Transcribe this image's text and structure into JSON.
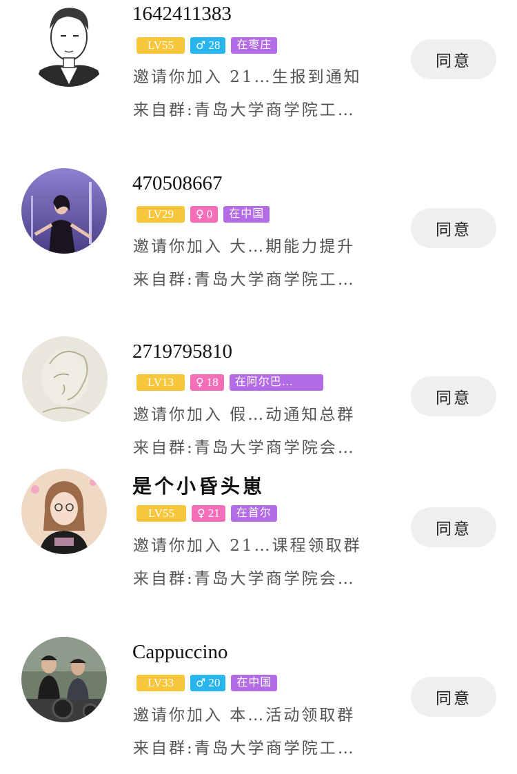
{
  "requests": [
    {
      "name": "1642411383",
      "level": "LV55",
      "gender_symbol": "♂",
      "gender": "male",
      "age": "28",
      "location": "在枣庄",
      "invite_text": "邀请你加入 21…生报到通知",
      "from_text": "来自群:青岛大学商学院工…",
      "button_label": "同意",
      "avatar_icon": "cartoon-man-avatar"
    },
    {
      "name": "470508667",
      "level": "LV29",
      "gender_symbol": "♀",
      "gender": "female",
      "age": "0",
      "location": "在中国",
      "invite_text": "邀请你加入 大…期能力提升",
      "from_text": "来自群:青岛大学商学院工…",
      "button_label": "同意",
      "avatar_icon": "woman-purple-photo-avatar"
    },
    {
      "name": "2719795810",
      "level": "LV13",
      "gender_symbol": "♀",
      "gender": "female",
      "age": "18",
      "location": "在阿尔巴…",
      "invite_text": "邀请你加入 假…动通知总群",
      "from_text": "来自群:青岛大学商学院会…",
      "button_label": "同意",
      "avatar_icon": "sketch-portrait-avatar"
    },
    {
      "name": "是个小昏头崽",
      "level": "LV55",
      "gender_symbol": "♀",
      "gender": "female",
      "age": "21",
      "location": "在首尔",
      "invite_text": "邀请你加入 21…课程领取群",
      "from_text": "来自群:青岛大学商学院会…",
      "button_label": "同意",
      "avatar_icon": "girl-photo-avatar"
    },
    {
      "name": "Cappuccino",
      "level": "LV33",
      "gender_symbol": "♂",
      "gender": "male",
      "age": "20",
      "location": "在中国",
      "invite_text": "邀请你加入 本…活动领取群",
      "from_text": "来自群:青岛大学商学院工…",
      "button_label": "同意",
      "avatar_icon": "group-photo-avatar"
    }
  ],
  "colors": {
    "level": "#f7c63a",
    "male": "#28b4ec",
    "female": "#f46fb8",
    "location": "#b36ce6",
    "button_bg": "#efeff1"
  }
}
